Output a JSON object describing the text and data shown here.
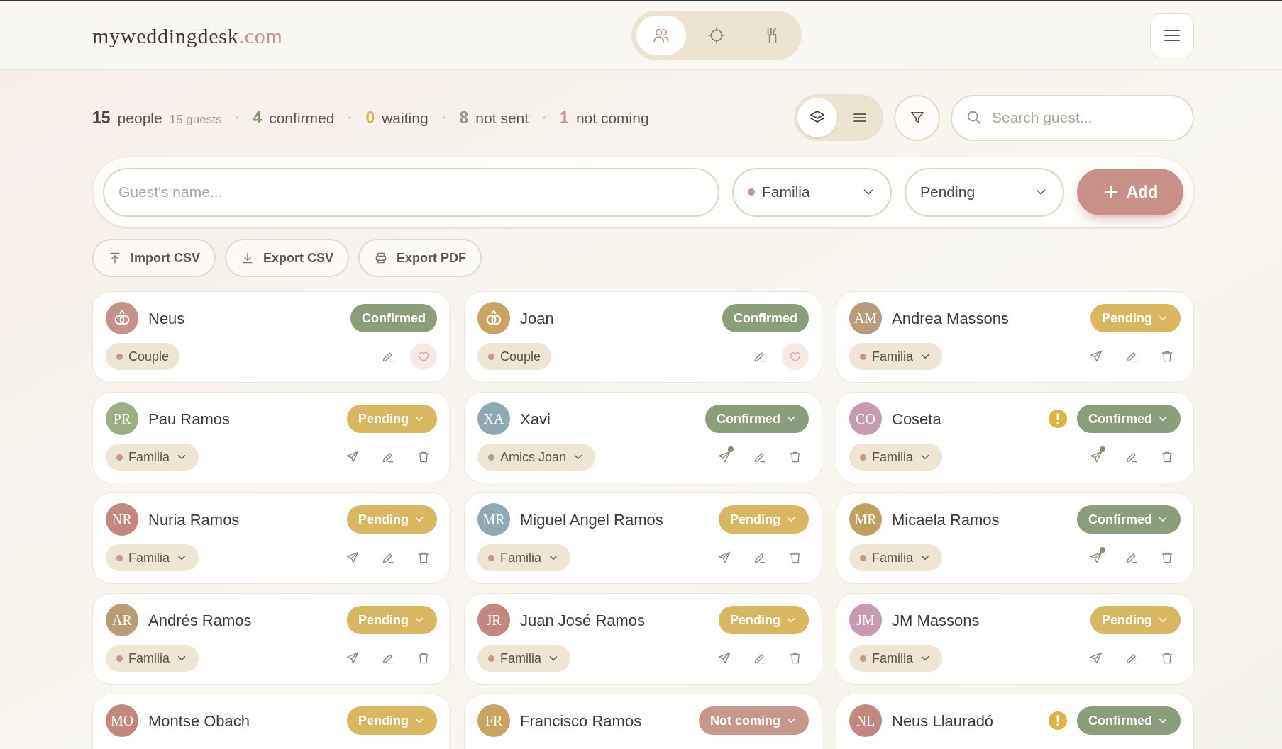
{
  "logo": {
    "name": "myweddingdesk",
    "suffix": ".com"
  },
  "nav_tabs": [
    {
      "selected": true
    },
    {
      "selected": false
    },
    {
      "selected": false
    }
  ],
  "stats": [
    {
      "count": "15",
      "label": "people",
      "extra": "15 guests",
      "color": "#4a4540"
    },
    {
      "count": "4",
      "label": "confirmed",
      "color": "#7f9670"
    },
    {
      "count": "0",
      "label": "waiting",
      "color": "#d4ad4f"
    },
    {
      "count": "8",
      "label": "not sent",
      "color": "#9a9388"
    },
    {
      "count": "1",
      "label": "not coming",
      "color": "#c98e87"
    }
  ],
  "view_toggle": [
    {
      "selected": true
    },
    {
      "selected": false
    }
  ],
  "search": {
    "placeholder": "Search guest..."
  },
  "new_guest": {
    "placeholder": "Guest's name...",
    "group": {
      "label": "Familia",
      "color": "#c9958d"
    },
    "status": "Pending",
    "add": "Add"
  },
  "file_buttons": [
    "Import CSV",
    "Export CSV",
    "Export PDF"
  ],
  "guests": [
    {
      "kind": "couple",
      "name": "Neus",
      "color": "#c4928a",
      "status": {
        "label": "Confirmed",
        "kind": "confirmed"
      },
      "group": {
        "label": "Couple",
        "color": "#c9958d"
      }
    },
    {
      "kind": "couple",
      "name": "Joan",
      "color": "#c9a35f",
      "status": {
        "label": "Confirmed",
        "kind": "confirmed"
      },
      "group": {
        "label": "Couple",
        "color": "#c9958d"
      }
    },
    {
      "kind": "guest",
      "initials": "AM",
      "name": "Andrea Massons",
      "color": "#b89c78",
      "status": {
        "label": "Pending",
        "kind": "pending"
      },
      "group": {
        "label": "Familia",
        "color": "#c9958d"
      },
      "sent": false,
      "warning": false
    },
    {
      "kind": "guest",
      "initials": "PR",
      "name": "Pau Ramos",
      "color": "#9cae84",
      "status": {
        "label": "Pending",
        "kind": "pending"
      },
      "group": {
        "label": "Familia",
        "color": "#c9958d"
      },
      "sent": false,
      "warning": false
    },
    {
      "kind": "guest",
      "initials": "XA",
      "name": "Xavi",
      "color": "#8fa9b3",
      "status": {
        "label": "Confirmed",
        "kind": "confirmed"
      },
      "group": {
        "label": "Amics Joan",
        "color": "#a8a39a"
      },
      "sent": true,
      "warning": false
    },
    {
      "kind": "guest",
      "initials": "CO",
      "name": "Coseta",
      "color": "#c49bb0",
      "status": {
        "label": "Confirmed",
        "kind": "confirmed"
      },
      "group": {
        "label": "Familia",
        "color": "#c9958d"
      },
      "sent": true,
      "warning": true
    },
    {
      "kind": "guest",
      "initials": "NR",
      "name": "Nuria Ramos",
      "color": "#c4877f",
      "status": {
        "label": "Pending",
        "kind": "pending"
      },
      "group": {
        "label": "Familia",
        "color": "#c9958d"
      },
      "sent": false,
      "warning": false
    },
    {
      "kind": "guest",
      "initials": "MR",
      "name": "Miguel Angel Ramos",
      "color": "#8fa9b3",
      "status": {
        "label": "Pending",
        "kind": "pending"
      },
      "group": {
        "label": "Familia",
        "color": "#c9958d"
      },
      "sent": false,
      "warning": false
    },
    {
      "kind": "guest",
      "initials": "MR",
      "name": "Micaela Ramos",
      "color": "#c0a060",
      "status": {
        "label": "Confirmed",
        "kind": "confirmed"
      },
      "group": {
        "label": "Familia",
        "color": "#c9958d"
      },
      "sent": true,
      "warning": false
    },
    {
      "kind": "guest",
      "initials": "AR",
      "name": "Andrés Ramos",
      "color": "#b89c78",
      "status": {
        "label": "Pending",
        "kind": "pending"
      },
      "group": {
        "label": "Familia",
        "color": "#c9958d"
      },
      "sent": false,
      "warning": false
    },
    {
      "kind": "guest",
      "initials": "JR",
      "name": "Juan José Ramos",
      "color": "#c4877f",
      "status": {
        "label": "Pending",
        "kind": "pending"
      },
      "group": {
        "label": "Familia",
        "color": "#c9958d"
      },
      "sent": false,
      "warning": false
    },
    {
      "kind": "guest",
      "initials": "JM",
      "name": "JM Massons",
      "color": "#c49bb0",
      "status": {
        "label": "Pending",
        "kind": "pending"
      },
      "group": {
        "label": "Familia",
        "color": "#c9958d"
      },
      "sent": false,
      "warning": false
    },
    {
      "kind": "guest",
      "initials": "MO",
      "name": "Montse Obach",
      "color": "#c4877f",
      "status": {
        "label": "Pending",
        "kind": "pending"
      },
      "warning": false
    },
    {
      "kind": "guest",
      "initials": "FR",
      "name": "Francisco Ramos",
      "color": "#c9a35f",
      "status": {
        "label": "Not coming",
        "kind": "declined"
      },
      "warning": false
    },
    {
      "kind": "guest",
      "initials": "NL",
      "name": "Neus Llauradó",
      "color": "#c4877f",
      "status": {
        "label": "Confirmed",
        "kind": "confirmed"
      },
      "warning": true
    }
  ]
}
